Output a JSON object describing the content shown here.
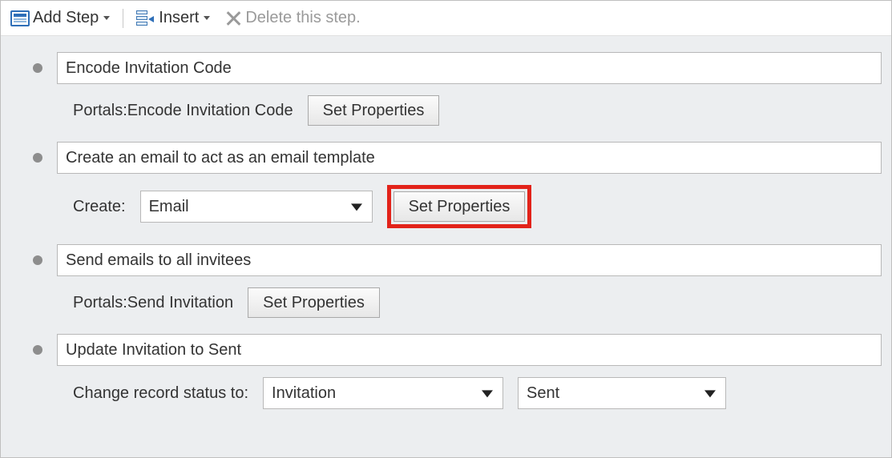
{
  "toolbar": {
    "add_step_label": "Add Step",
    "insert_label": "Insert",
    "delete_label": "Delete this step."
  },
  "steps": [
    {
      "title": "Encode Invitation Code",
      "action_label": "Portals:Encode Invitation Code",
      "set_properties_label": "Set Properties"
    },
    {
      "title": "Create an email to act as an email template",
      "create_label": "Create:",
      "create_entity": "Email",
      "set_properties_label": "Set Properties"
    },
    {
      "title": "Send emails to all invitees",
      "action_label": "Portals:Send Invitation",
      "set_properties_label": "Set Properties"
    },
    {
      "title": "Update Invitation to Sent",
      "change_status_label": "Change record status to:",
      "status_entity": "Invitation",
      "status_value": "Sent"
    }
  ]
}
